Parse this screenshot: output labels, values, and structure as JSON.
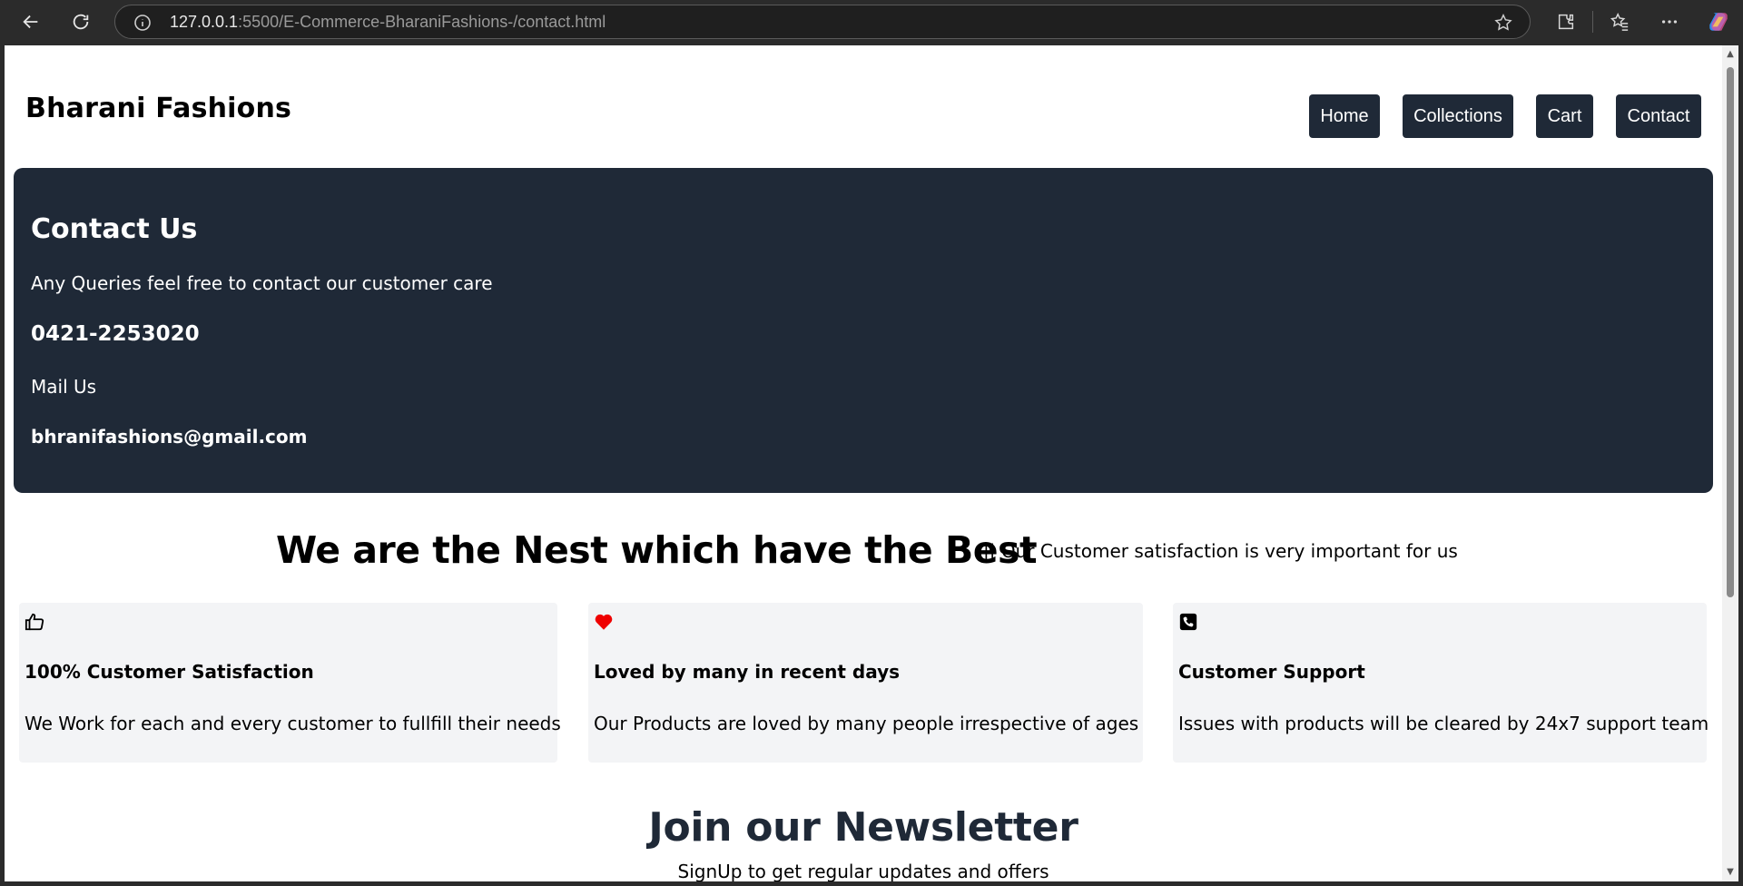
{
  "browser": {
    "url_host": "127.0.0.1",
    "url_rest": ":5500/E-Commerce-BharaniFashions-/contact.html"
  },
  "site": {
    "brand": "Bharani Fashions",
    "nav": [
      "Home",
      "Collections",
      "Cart",
      "Contact"
    ]
  },
  "contact": {
    "heading": "Contact Us",
    "intro": "Any Queries feel free to contact our customer care",
    "phone": "0421-2253020",
    "mail_label": "Mail Us",
    "email": "bhranifashions@gmail.com"
  },
  "nest": {
    "title": "We are the Nest which have the Best",
    "subtitle": "|| Our Customer satisfaction is very important for us"
  },
  "features": [
    {
      "icon": "thumbs-up-icon",
      "title": "100% Customer Satisfaction",
      "desc": "We Work for each and every customer to fullfill their needs"
    },
    {
      "icon": "heart-icon",
      "title": "Loved by many in recent days",
      "desc": "Our Products are loved by many people irrespective of ages"
    },
    {
      "icon": "phone-icon",
      "title": "Customer Support",
      "desc": "Issues with products will be cleared by 24x7 support team"
    }
  ],
  "newsletter": {
    "title": "Join our Newsletter",
    "subtitle": "SignUp to get regular updates and offers"
  },
  "colors": {
    "dark": "#1f2937",
    "card_bg": "#f3f4f6",
    "heart": "#ef0000"
  }
}
